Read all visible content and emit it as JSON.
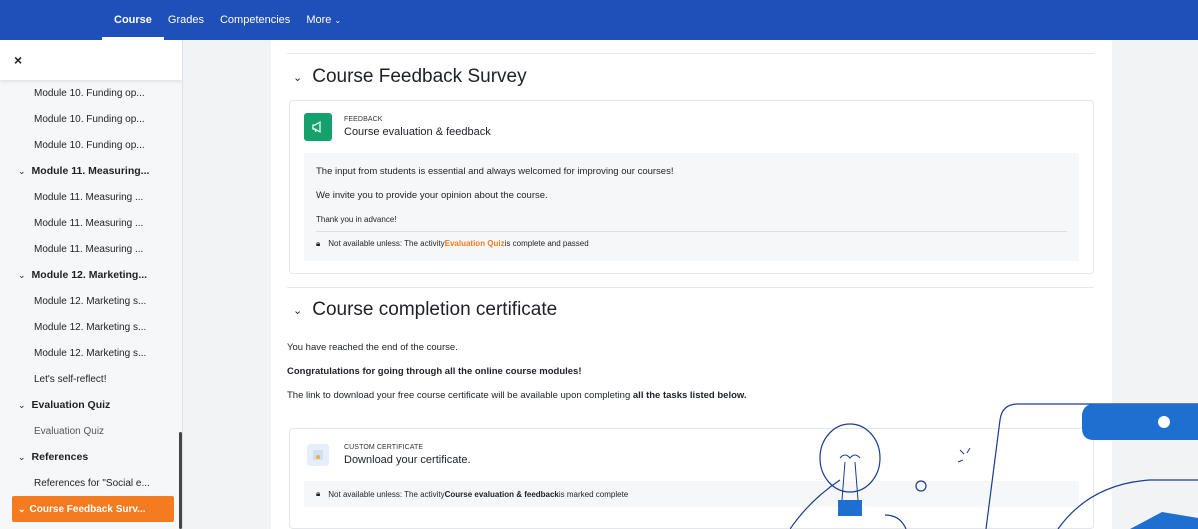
{
  "nav": {
    "tabs": [
      {
        "label": "Course"
      },
      {
        "label": "Grades"
      },
      {
        "label": "Competencies"
      },
      {
        "label": "More"
      }
    ]
  },
  "drawer": {
    "close_label": "×",
    "items": [
      {
        "label": "Module 10. Funding op..."
      },
      {
        "label": "Module 10. Funding op..."
      },
      {
        "label": "Module 10. Funding op..."
      },
      {
        "label": "Module 11. Measuring..."
      },
      {
        "label": "Module 11. Measuring ..."
      },
      {
        "label": "Module 11. Measuring ..."
      },
      {
        "label": "Module 11. Measuring ..."
      },
      {
        "label": "Module 12. Marketing..."
      },
      {
        "label": "Module 12. Marketing s..."
      },
      {
        "label": "Module 12. Marketing s..."
      },
      {
        "label": "Module 12. Marketing s..."
      },
      {
        "label": "Let's self-reflect!"
      },
      {
        "label": "Evaluation Quiz"
      },
      {
        "label": "Evaluation Quiz"
      },
      {
        "label": "References"
      },
      {
        "label": "References for \"Social e..."
      },
      {
        "label": "Course Feedback Surv..."
      }
    ]
  },
  "feedback": {
    "title": "Course Feedback Survey",
    "activity_type": "FEEDBACK",
    "activity_name": "Course evaluation & feedback",
    "line1": "The input from students is essential and always welcomed for improving our courses!",
    "line2": "We invite you to provide your opinion about the course.",
    "line3": "Thank you in advance!",
    "restrict_pre": "Not available unless: The activity ",
    "restrict_link": "Evaluation Quiz",
    "restrict_post": " is complete and passed"
  },
  "certificate": {
    "title": "Course completion certificate",
    "p1": "You have reached the end of the course.",
    "p2": "Congratulations for going through all the online course modules!",
    "p3_pre": "The link to download your free course certificate will be available upon completing ",
    "p3_bold": "all the tasks listed below.",
    "activity_type": "CUSTOM CERTIFICATE",
    "activity_name": "Download your certificate.",
    "restrict_pre": "Not available unless: The activity ",
    "restrict_bold": "Course evaluation & feedback",
    "restrict_post": " is marked complete"
  },
  "colors": {
    "nav_bg": "#1f4fb8",
    "accent": "#f47b20",
    "feedback_icon": "#15a16b"
  }
}
